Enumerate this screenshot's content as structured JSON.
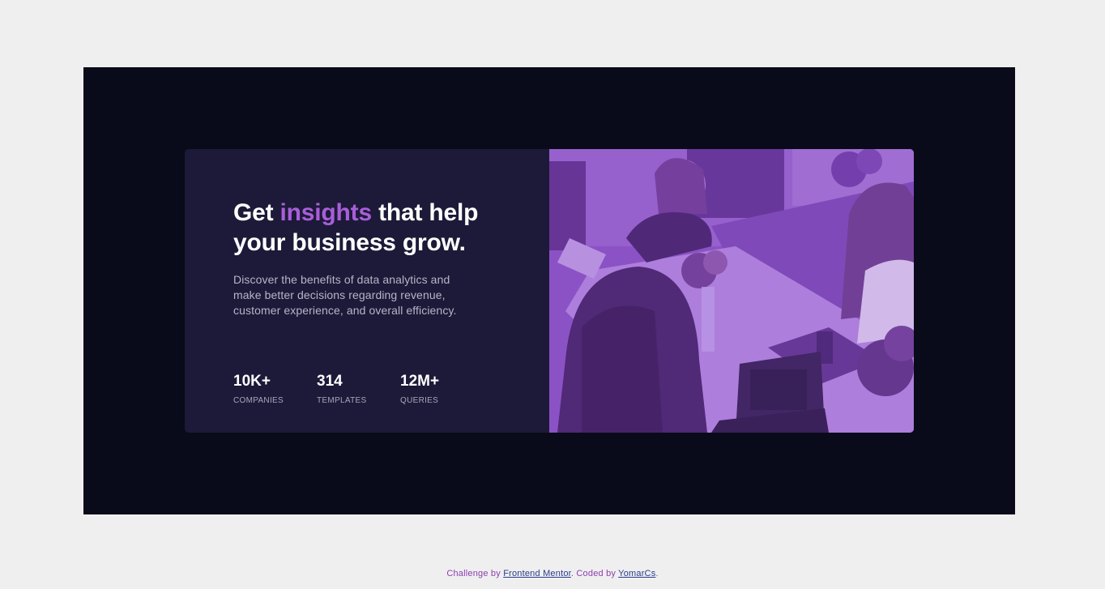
{
  "card": {
    "headline": {
      "before": "Get ",
      "accent": "insights",
      "after": " that help your business grow."
    },
    "description": "Discover the benefits of data analytics and make better decisions regarding revenue, customer experience, and overall efficiency.",
    "stats": [
      {
        "value": "10K+",
        "label": "COMPANIES"
      },
      {
        "value": "314",
        "label": "TEMPLATES"
      },
      {
        "value": "12M+",
        "label": "QUERIES"
      }
    ]
  },
  "attribution": {
    "prefix": "Challenge by ",
    "link1": "Frontend Mentor",
    "middle": ". Coded by ",
    "link2": "YomarCs",
    "suffix": "."
  },
  "colors": {
    "page_background": "#efefef",
    "stage_background": "#090b1a",
    "card_background": "#1c1a38",
    "accent": "#a95ed9",
    "image_overlay": "#8a4fc8"
  }
}
